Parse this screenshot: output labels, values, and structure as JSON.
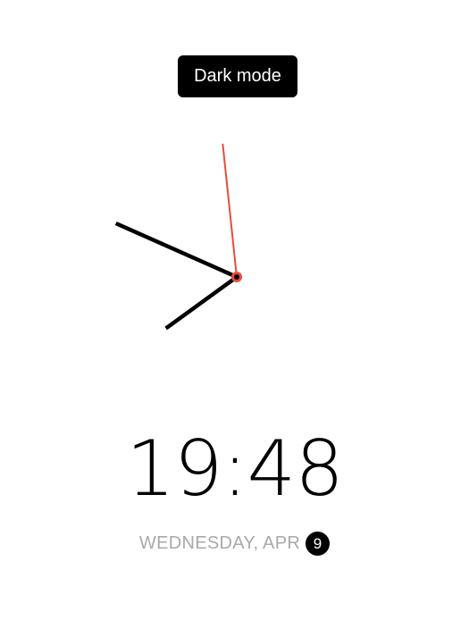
{
  "toolbar": {
    "mode_toggle_label": "Dark mode"
  },
  "clock": {
    "hour": 19,
    "minute": 48,
    "second": 59,
    "colors": {
      "hands": "#000000",
      "second_hand": "#e74c3c",
      "center_ring": "#e74c3c"
    }
  },
  "digital": {
    "time": "19:48"
  },
  "date": {
    "text": "WEDNESDAY, APR",
    "day": "9"
  },
  "colors": {
    "background": "#ffffff",
    "button_bg": "#000000",
    "button_text": "#ffffff",
    "date_text": "#a9a9a9",
    "badge_bg": "#000000"
  }
}
